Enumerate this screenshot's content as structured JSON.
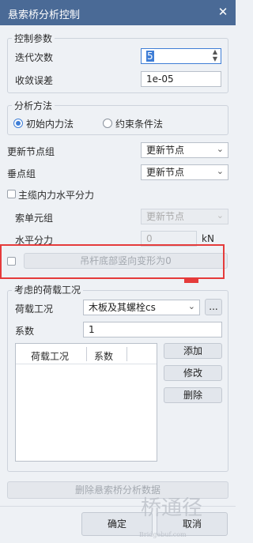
{
  "window": {
    "title": "悬索桥分析控制",
    "close_glyph": "✕"
  },
  "control_params": {
    "group_title": "控制参数",
    "iter_label": "迭代次数",
    "iter_value": "5",
    "tol_label": "收敛误差",
    "tol_value": "1e-05"
  },
  "analysis_method": {
    "group_title": "分析方法",
    "option1": "初始内力法",
    "option2": "约束条件法",
    "selected": "初始内力法"
  },
  "node_groups": {
    "update_label": "更新节点组",
    "update_value": "更新节点",
    "sag_label": "垂点组",
    "sag_value": "更新节点"
  },
  "cable_force": {
    "checkbox_label": "主缆内力水平分力",
    "element_group_label": "索单元组",
    "element_group_value": "更新节点",
    "horizontal_label": "水平分力",
    "horizontal_value": "0",
    "unit": "kN"
  },
  "hanger": {
    "button_label": "吊杆底部竖向变形为0"
  },
  "load_cases": {
    "group_title": "考虑的荷载工况",
    "case_label": "荷载工况",
    "case_value": "木板及其螺栓cs",
    "more_button": "...",
    "factor_label": "系数",
    "factor_value": "1",
    "col_case": "荷载工况",
    "col_factor": "系数",
    "add_button": "添加",
    "edit_button": "修改",
    "delete_button": "删除"
  },
  "footer": {
    "delete_data_button": "删除悬索桥分析数据",
    "ok_button": "确定",
    "cancel_button": "取消"
  },
  "watermark": {
    "logo_text": "桥通径",
    "url": "Bridgebuf.com"
  },
  "colors": {
    "title_bar": "#4a6a96",
    "accent": "#3f7ed6",
    "highlight_frame": "#e53b3b"
  }
}
